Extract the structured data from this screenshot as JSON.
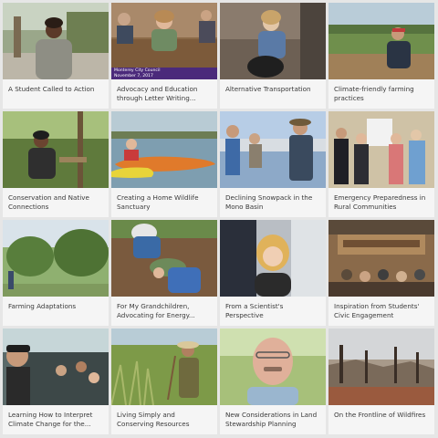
{
  "tiles": [
    {
      "caption": "A Student Called to Action",
      "thumb": "student-portrait-photo"
    },
    {
      "caption": "Advocacy and Education through Letter Writing...",
      "thumb": "council-meeting-photo",
      "overlay_title": "Monterey City Council",
      "overlay_date": "November 7, 2017"
    },
    {
      "caption": "Alternative Transportation",
      "thumb": "woman-with-dog-photo"
    },
    {
      "caption": "Climate-friendly farming practices",
      "thumb": "farmer-in-field-photo"
    },
    {
      "caption": "Conservation and Native Connections",
      "thumb": "man-in-woods-photo"
    },
    {
      "caption": "Creating a Home Wildlife Sanctuary",
      "thumb": "kayak-on-lake-photo"
    },
    {
      "caption": "Declining Snowpack in the Mono Basin",
      "thumb": "ranger-talk-photo"
    },
    {
      "caption": "Emergency Preparedness in Rural Communities",
      "thumb": "group-indoors-photo"
    },
    {
      "caption": "Farming Adaptations",
      "thumb": "orchard-trees-photo"
    },
    {
      "caption": "For My Grandchildren, Advocating for Energy...",
      "thumb": "gardening-photo"
    },
    {
      "caption": "From a Scientist's Perspective",
      "thumb": "scientist-portrait-photo"
    },
    {
      "caption": "Inspiration from Students' Civic Engagement",
      "thumb": "auditorium-meeting-photo"
    },
    {
      "caption": "Learning How to Interpret Climate Change for the...",
      "thumb": "bus-passengers-photo"
    },
    {
      "caption": "Living Simply and Conserving Resources",
      "thumb": "man-in-tall-grass-photo"
    },
    {
      "caption": "New Considerations in Land Stewardship Planning",
      "thumb": "smiling-man-portrait-photo"
    },
    {
      "caption": "On the Frontline of Wildfires",
      "thumb": "burned-forest-photo"
    }
  ]
}
